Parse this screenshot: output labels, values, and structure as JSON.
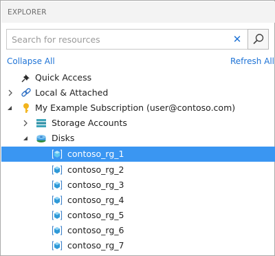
{
  "panel": {
    "title": "EXPLORER"
  },
  "search": {
    "placeholder": "Search for resources",
    "value": "",
    "clear_glyph": "✕"
  },
  "actions": {
    "collapse_all": "Collapse All",
    "refresh_all": "Refresh All"
  },
  "tree": {
    "quick_access": {
      "label": "Quick Access",
      "icon": "pin-icon"
    },
    "local_attached": {
      "label": "Local & Attached",
      "icon": "link-icon",
      "expanded": false
    },
    "subscription": {
      "label": "My Example Subscription (user@contoso.com)",
      "icon": "key-icon",
      "expanded": true
    },
    "storage_accounts": {
      "label": "Storage Accounts",
      "icon": "storage-accounts-icon",
      "expanded": false
    },
    "disks": {
      "label": "Disks",
      "icon": "disks-icon",
      "expanded": true
    },
    "disk_items": [
      {
        "label": "contoso_rg_1",
        "selected": true
      },
      {
        "label": "contoso_rg_2",
        "selected": false
      },
      {
        "label": "contoso_rg_3",
        "selected": false
      },
      {
        "label": "contoso_rg_4",
        "selected": false
      },
      {
        "label": "contoso_rg_5",
        "selected": false
      },
      {
        "label": "contoso_rg_6",
        "selected": false
      },
      {
        "label": "contoso_rg_7",
        "selected": false
      }
    ]
  },
  "colors": {
    "accent": "#1e73d6",
    "selection": "#3a96f2",
    "header_bg": "#f3f3f3"
  }
}
